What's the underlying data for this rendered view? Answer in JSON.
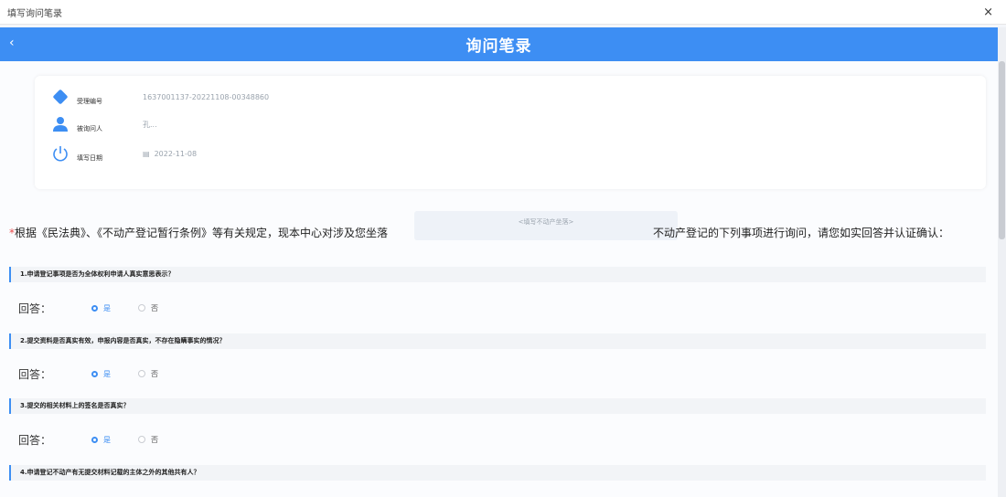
{
  "window": {
    "title": "填写询问笔录",
    "close": "×"
  },
  "header": {
    "back": "‹",
    "title": "询问笔录"
  },
  "info": {
    "case_no": {
      "label": "受理编号",
      "value": "1637001137-20221108-00348860"
    },
    "person": {
      "label": "被询问人",
      "value": "孔..."
    },
    "date": {
      "label": "填写日期",
      "value": "2022-11-08"
    }
  },
  "intro": {
    "required_mark": "*",
    "before": "根据《民法典》、《不动产登记暂行条例》等有关规定，现本中心对涉及您坐落",
    "placeholder": "<填写不动产坐落>",
    "after": "不动产登记的下列事项进行询问，请您如实回答并认证确认："
  },
  "answer_label": "回答：",
  "option_yes": "是",
  "option_no": "否",
  "questions": [
    {
      "text": "1.申请登记事项是否为全体权利申请人真实意思表示？"
    },
    {
      "text": "2.提交资料是否真实有效，申报内容是否真实，不存在隐瞒事实的情况？"
    },
    {
      "text": "3.提交的相关材料上的签名是否真实？"
    },
    {
      "text": "4.申请登记不动产有无提交材料记载的主体之外的其他共有人？"
    }
  ],
  "colors": {
    "accent": "#3d8ef3",
    "required": "#e84b4b"
  }
}
